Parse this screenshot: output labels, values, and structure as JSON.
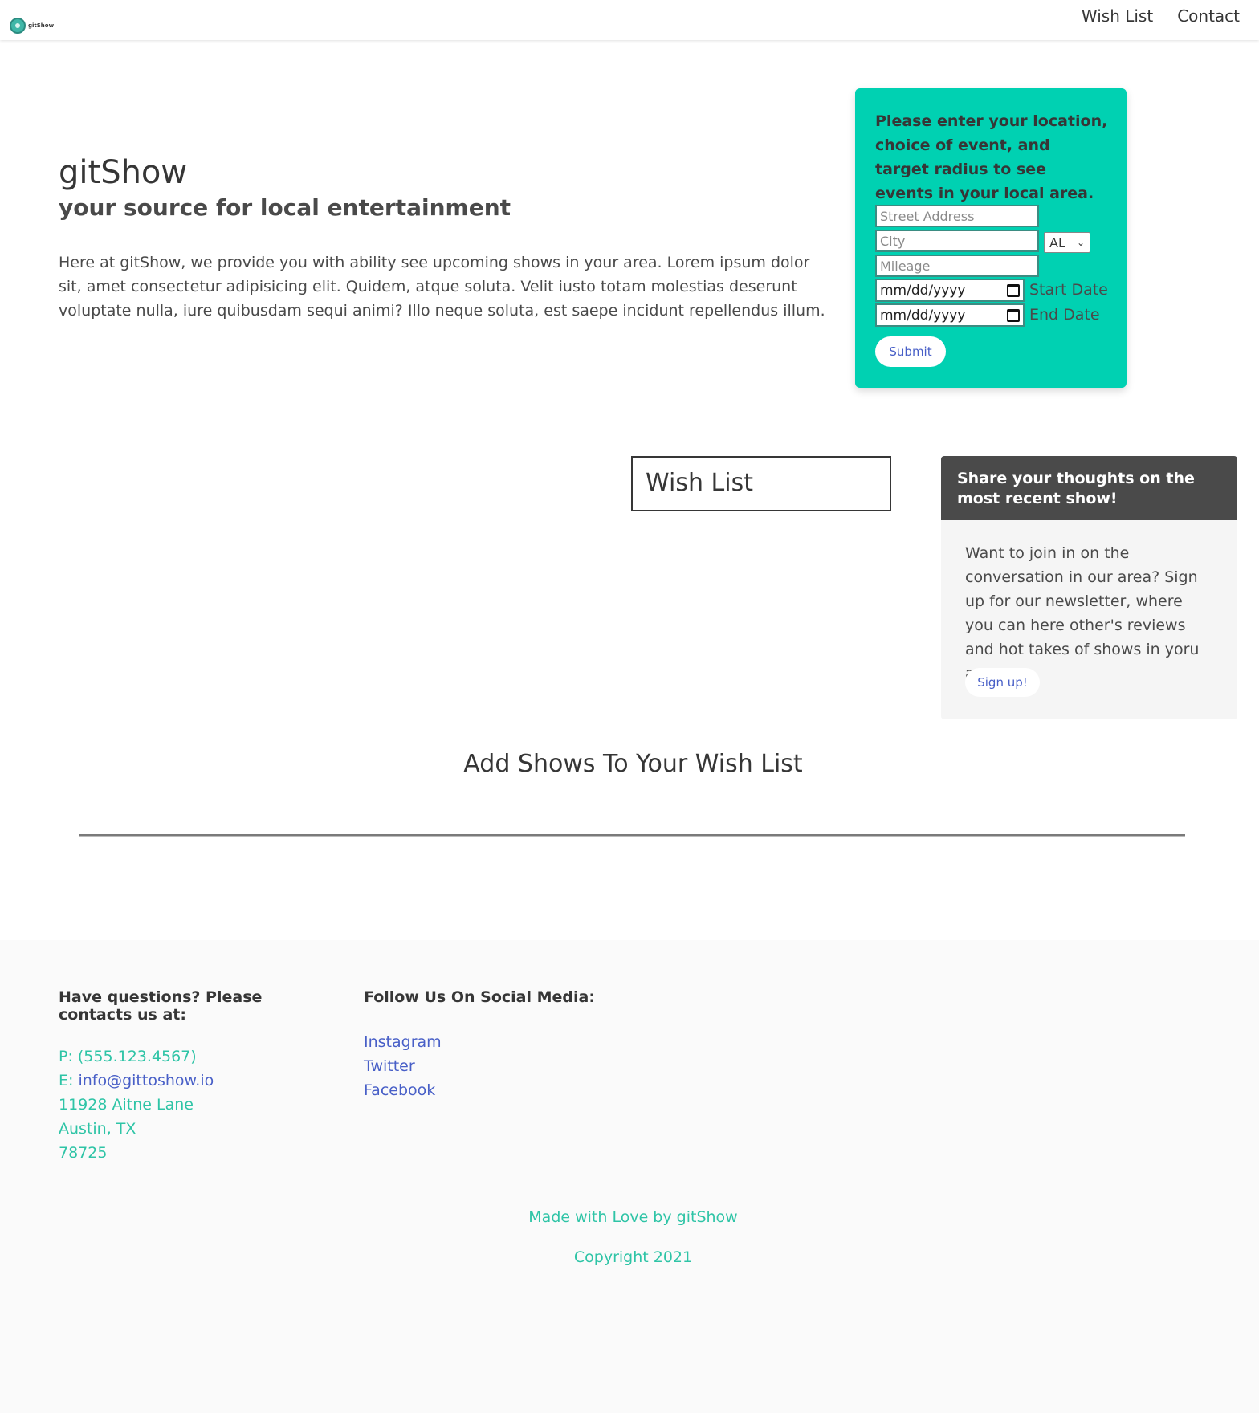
{
  "nav": {
    "logo_text": "gitShow",
    "links": [
      "Wish List",
      "Contact"
    ]
  },
  "hero": {
    "title": "gitShow",
    "subtitle": "your source for local entertainment",
    "description": "Here at gitShow, we provide you with ability see upcoming shows in your area. Lorem ipsum dolor sit, amet consectetur adipisicing elit. Quidem, atque soluta. Velit iusto totam molestias deserunt voluptate nulla, iure quibusdam sequi animi? Illo neque soluta, est saepe incidunt repellendus illum."
  },
  "search": {
    "prompt": "Please enter your location, choice of event, and target radius to see events in your local area.",
    "street_placeholder": "Street Address",
    "city_placeholder": "City",
    "state_value": "AL",
    "mileage_placeholder": "Mileage",
    "date_placeholder": "mm/dd/yyyy",
    "start_label": "Start Date",
    "end_label": "End Date",
    "submit_label": "Submit"
  },
  "wishlist": {
    "title": "Wish List"
  },
  "share": {
    "heading": "Share your thoughts on the most recent show!",
    "body": "Want to join in on the conversation in our area? Sign up for our newsletter, where you can here other's reviews and hot takes of shows in yoru area",
    "button": "Sign up!"
  },
  "add_shows": {
    "heading": "Add Shows To Your Wish List"
  },
  "footer": {
    "contact_heading": "Have questions? Please contacts us at:",
    "phone": "P: (555.123.4567)",
    "email_prefix": "E: ",
    "email": "info@gittoshow.io",
    "address_line1": "11928 Aitne Lane",
    "address_line2": "Austin, TX",
    "address_line3": "78725",
    "social_heading": "Follow Us On Social Media:",
    "social_links": [
      "Instagram",
      "Twitter",
      "Facebook"
    ],
    "made_with": "Made with Love by gitShow",
    "copyright": "Copyright 2021"
  },
  "colors": {
    "primary": "#00d1b2",
    "link": "#485fc7",
    "dark": "#4a4a4a",
    "footer_text": "#2ec4a6"
  }
}
